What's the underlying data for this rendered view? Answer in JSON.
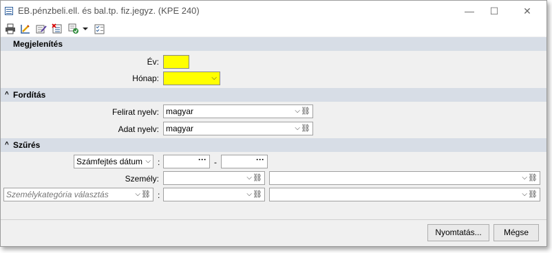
{
  "window": {
    "title": "EB.pénzbeli.ell. és bal.tp. fiz.jegyz. (KPE 240)",
    "controls": {
      "minimize": "—",
      "maximize": "☐",
      "close": "✕"
    }
  },
  "toolbar": {
    "icons": [
      "print-icon",
      "edit-ruler-icon",
      "edit-form-icon",
      "delete-list-icon",
      "refresh-options-icon",
      "dropdown-arrow-icon",
      "checklist-icon"
    ]
  },
  "sections": {
    "megjelenites": {
      "title": "Megjelenítés"
    },
    "forditas": {
      "title": "Fordítás",
      "caret": "^"
    },
    "szures": {
      "title": "Szűrés",
      "caret": "^"
    }
  },
  "fields": {
    "ev": {
      "label": "Év:",
      "value": ""
    },
    "honap": {
      "label": "Hónap:",
      "value": ""
    },
    "felirat_nyelv": {
      "label": "Felirat nyelv:",
      "value": "magyar"
    },
    "adat_nyelv": {
      "label": "Adat nyelv:",
      "value": "magyar"
    },
    "date_type": {
      "value": "Számfejtés dátum",
      "colon": ":"
    },
    "date_from": {
      "value": "",
      "dots": "···"
    },
    "date_sep": "-",
    "date_to": {
      "value": "",
      "dots": "···"
    },
    "szemely": {
      "label": "Személy:",
      "value": "",
      "value2": ""
    },
    "szemelykategoria": {
      "placeholder": "Személykategória választás",
      "colon": ":",
      "value": "",
      "value2": ""
    }
  },
  "symbols": {
    "chevron": "⌵",
    "clip": "⛓"
  },
  "footer": {
    "print_label": "Nyomtatás...",
    "cancel_label": "Mégse"
  },
  "colors": {
    "required_field": "#ffff00",
    "section_bg": "#d7dde6"
  }
}
